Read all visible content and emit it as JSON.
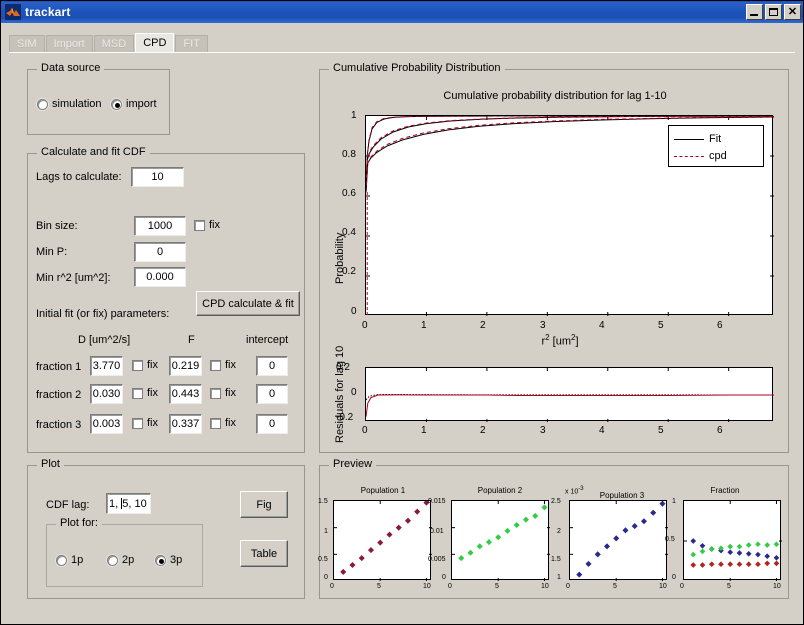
{
  "window": {
    "title": "trackart",
    "icon": "matlab-logo-icon",
    "minimize_label": "–",
    "maximize_label": "□",
    "close_label": "✕"
  },
  "tabs": [
    {
      "label": "SIM",
      "active": false
    },
    {
      "label": "Import",
      "active": false
    },
    {
      "label": "MSD",
      "active": false
    },
    {
      "label": "CPD",
      "active": true
    },
    {
      "label": "FIT",
      "active": false
    }
  ],
  "data_source": {
    "title": "Data source",
    "options": [
      {
        "label": "simulation",
        "selected": false
      },
      {
        "label": "import",
        "selected": true
      }
    ]
  },
  "calc_panel": {
    "title": "Calculate and fit CDF",
    "lags_label": "Lags to calculate:",
    "lags_value": "10",
    "bin_label": "Bin size:",
    "bin_value": "1000",
    "bin_fix_label": "fix",
    "bin_fix_checked": false,
    "minp_label": "Min P:",
    "minp_value": "0",
    "minr2_label": "Min r^2 [um^2]:",
    "minr2_value": "0.000",
    "calc_button": "CPD calculate & fit",
    "initial_label": "Initial fit (or fix) parameters:",
    "col_d": "D [um^2/s]",
    "col_f": "F",
    "col_intercept": "intercept",
    "fix_label": "fix",
    "rows": [
      {
        "name": "fraction 1",
        "d": "3.770",
        "d_fix": false,
        "f": "0.219",
        "f_fix": false,
        "intercept": "0"
      },
      {
        "name": "fraction 2",
        "d": "0.030",
        "d_fix": false,
        "f": "0.443",
        "f_fix": false,
        "intercept": "0"
      },
      {
        "name": "fraction 3",
        "d": "0.003",
        "d_fix": false,
        "f": "0.337",
        "f_fix": false,
        "intercept": "0"
      }
    ]
  },
  "plot_panel": {
    "title": "Plot",
    "cdf_lag_label": "CDF lag:",
    "cdf_lag_value": "1, 5, 10",
    "plot_for_title": "Plot for:",
    "plot_for_options": [
      {
        "label": "1p",
        "selected": false
      },
      {
        "label": "2p",
        "selected": false
      },
      {
        "label": "3p",
        "selected": true
      }
    ],
    "fig_button": "Fig",
    "table_button": "Table"
  },
  "cpd_panel": {
    "title": "Cumulative Probability Distribution"
  },
  "preview_panel": {
    "title": "Preview"
  },
  "chart_data": [
    {
      "id": "main-cpd",
      "type": "line",
      "title": "Cumulative probability distribution for lag 1-10",
      "xlabel": "r² [um²]",
      "ylabel": "Probability",
      "xlim": [
        0,
        6.75
      ],
      "ylim": [
        0,
        1
      ],
      "xticks": [
        0,
        1,
        2,
        3,
        4,
        5,
        6
      ],
      "yticks": [
        0,
        0.2,
        0.4,
        0.6,
        0.8,
        1
      ],
      "grid": false,
      "legend": {
        "position": "top-right",
        "entries": [
          {
            "label": "Fit",
            "style": "solid",
            "color": "#000000"
          },
          {
            "label": "cpd",
            "style": "dashed",
            "color": "#b00020"
          }
        ]
      },
      "series": [
        {
          "name": "Fit lag 1",
          "style": "solid",
          "color": "#000000",
          "x": [
            0,
            0.02,
            0.05,
            0.1,
            0.18,
            0.3,
            0.45,
            0.65,
            0.9,
            1.2,
            1.6,
            2.1,
            2.7,
            3.4,
            4.2,
            5.1,
            6.0,
            6.75
          ],
          "y": [
            0.62,
            0.8,
            0.875,
            0.935,
            0.968,
            0.985,
            0.993,
            0.9965,
            0.998,
            0.999,
            0.9995,
            0.9997,
            0.9998,
            0.9999,
            0.9999,
            1.0,
            1.0,
            1.0
          ]
        },
        {
          "name": "Fit lag 5",
          "style": "solid",
          "color": "#000000",
          "x": [
            0,
            0.02,
            0.06,
            0.12,
            0.25,
            0.45,
            0.7,
            1.0,
            1.4,
            1.9,
            2.5,
            3.2,
            4.0,
            4.9,
            5.8,
            6.75
          ],
          "y": [
            0.62,
            0.78,
            0.815,
            0.845,
            0.885,
            0.92,
            0.945,
            0.962,
            0.975,
            0.984,
            0.99,
            0.994,
            0.9965,
            0.998,
            0.999,
            0.9995
          ]
        },
        {
          "name": "Fit lag 10",
          "style": "solid",
          "color": "#000000",
          "x": [
            0,
            0.03,
            0.08,
            0.18,
            0.35,
            0.6,
            0.95,
            1.35,
            1.85,
            2.45,
            3.1,
            3.9,
            4.7,
            5.6,
            6.75
          ],
          "y": [
            0.62,
            0.765,
            0.79,
            0.818,
            0.85,
            0.88,
            0.908,
            0.93,
            0.948,
            0.962,
            0.972,
            0.98,
            0.986,
            0.991,
            0.995
          ]
        },
        {
          "name": "cpd lag 1",
          "style": "dashed",
          "color": "#b00020",
          "x": [
            0,
            0.02,
            0.05,
            0.1,
            0.18,
            0.3,
            0.45,
            0.65,
            0.9,
            1.2,
            1.6,
            2.1,
            2.7,
            3.4,
            4.2,
            5.1,
            6.0,
            6.75
          ],
          "y": [
            0.62,
            0.8,
            0.882,
            0.942,
            0.972,
            0.988,
            0.994,
            0.997,
            0.9985,
            0.999,
            0.9995,
            0.9997,
            0.9998,
            0.9999,
            1.0,
            1.0,
            1.0,
            1.0
          ]
        },
        {
          "name": "cpd lag 5",
          "style": "dashed",
          "color": "#b00020",
          "x": [
            0,
            0.02,
            0.06,
            0.12,
            0.25,
            0.45,
            0.7,
            1.0,
            1.4,
            1.9,
            2.5,
            3.2,
            4.0,
            4.9,
            5.8,
            6.75
          ],
          "y": [
            0.62,
            0.78,
            0.822,
            0.852,
            0.892,
            0.926,
            0.949,
            0.965,
            0.977,
            0.985,
            0.991,
            0.995,
            0.997,
            0.9985,
            0.9992,
            0.9996
          ]
        },
        {
          "name": "cpd lag 10",
          "style": "dashed",
          "color": "#b00020",
          "x": [
            0,
            0.03,
            0.08,
            0.18,
            0.35,
            0.6,
            0.95,
            1.35,
            1.85,
            2.45,
            3.1,
            3.9,
            4.7,
            5.6,
            6.75
          ],
          "y": [
            0.62,
            0.765,
            0.795,
            0.825,
            0.858,
            0.888,
            0.915,
            0.936,
            0.953,
            0.966,
            0.975,
            0.983,
            0.988,
            0.993,
            0.996
          ]
        }
      ]
    },
    {
      "id": "residuals",
      "type": "line",
      "title": "",
      "ylabel": "Residuals for lag 10",
      "xlim": [
        0,
        6.75
      ],
      "ylim": [
        -0.2,
        0.2
      ],
      "xticks": [
        0,
        1,
        2,
        3,
        4,
        5,
        6
      ],
      "yticks": [
        -0.2,
        0,
        0.2
      ],
      "grid": false,
      "series": [
        {
          "name": "residual-black",
          "style": "dotted",
          "color": "#000000",
          "x": [
            0,
            0.05,
            0.1,
            0.2,
            0.4,
            0.8,
            1.2,
            2.0,
            3.0,
            4.0,
            5.0,
            6.0,
            6.75
          ],
          "y": [
            -0.035,
            -0.012,
            -0.004,
            0.003,
            0.004,
            0.003,
            0.002,
            0.001,
            0.001,
            0.001,
            0.001,
            0.0,
            0.0
          ]
        },
        {
          "name": "residual-red",
          "style": "solid",
          "color": "#b00020",
          "x": [
            0,
            0.03,
            0.08,
            0.2,
            0.5,
            1.0,
            2.0,
            2.5,
            3.5,
            5.0,
            6.0,
            6.75
          ],
          "y": [
            -0.16,
            -0.06,
            -0.02,
            0.0,
            0.001,
            0.0,
            0.0,
            -0.004,
            -0.004,
            -0.004,
            0.0,
            0.0
          ]
        }
      ]
    },
    {
      "id": "population-1",
      "type": "scatter",
      "title": "Population 1",
      "marker": "diamond",
      "color": "#8b1a3a",
      "xlim": [
        0,
        10.6
      ],
      "ylim": [
        0,
        1.5
      ],
      "xticks": [
        0,
        5,
        10
      ],
      "yticks": [
        0,
        0.5,
        1,
        1.5
      ],
      "x": [
        1,
        2,
        3,
        4,
        5,
        6,
        7,
        8,
        9,
        10
      ],
      "y": [
        0.17,
        0.3,
        0.43,
        0.58,
        0.72,
        0.87,
        1.0,
        1.13,
        1.3,
        1.47
      ]
    },
    {
      "id": "population-2",
      "type": "scatter",
      "title": "Population 2",
      "marker": "diamond",
      "color": "#33cc44",
      "xlim": [
        0,
        10.6
      ],
      "ylim": [
        0,
        0.015
      ],
      "xticks": [
        0,
        5,
        10
      ],
      "yticks": [
        0,
        0.005,
        0.01,
        0.015
      ],
      "x": [
        1,
        2,
        3,
        4,
        5,
        6,
        7,
        8,
        9,
        10
      ],
      "y": [
        0.0043,
        0.0053,
        0.0065,
        0.0073,
        0.0082,
        0.0094,
        0.0105,
        0.0115,
        0.0122,
        0.0138
      ]
    },
    {
      "id": "population-3",
      "type": "scatter",
      "title": "Population 3",
      "marker": "diamond",
      "color": "#2a2a8c",
      "exponent_label": "x 10",
      "exponent_value": "-3",
      "xlim": [
        0,
        10.6
      ],
      "ylim": [
        1,
        2.5
      ],
      "xticks": [
        0,
        5,
        10
      ],
      "yticks": [
        1,
        1.5,
        2,
        2.5
      ],
      "x": [
        1,
        2,
        3,
        4,
        5,
        6,
        7,
        8,
        9,
        10
      ],
      "y": [
        1.12,
        1.32,
        1.5,
        1.65,
        1.8,
        1.95,
        2.03,
        2.12,
        2.28,
        2.45
      ]
    },
    {
      "id": "fraction",
      "type": "scatter",
      "title": "Fraction",
      "marker": "diamond",
      "xlim": [
        0,
        10.6
      ],
      "ylim": [
        0,
        1
      ],
      "xticks": [
        0,
        5,
        10
      ],
      "yticks": [
        0,
        0.5,
        1
      ],
      "series": [
        {
          "name": "fraction-1",
          "color": "#2a2a8c",
          "x": [
            1,
            2,
            3,
            4,
            5,
            6,
            7,
            8,
            9,
            10
          ],
          "y": [
            0.5,
            0.44,
            0.4,
            0.38,
            0.36,
            0.35,
            0.34,
            0.33,
            0.31,
            0.29
          ]
        },
        {
          "name": "fraction-2",
          "color": "#33cc44",
          "x": [
            1,
            2,
            3,
            4,
            5,
            6,
            7,
            8,
            9,
            10
          ],
          "y": [
            0.33,
            0.37,
            0.4,
            0.41,
            0.43,
            0.43,
            0.45,
            0.46,
            0.45,
            0.46
          ]
        },
        {
          "name": "fraction-3",
          "color": "#b0251f",
          "x": [
            1,
            2,
            3,
            4,
            5,
            6,
            7,
            8,
            9,
            10
          ],
          "y": [
            0.2,
            0.2,
            0.21,
            0.21,
            0.21,
            0.21,
            0.21,
            0.21,
            0.22,
            0.22
          ]
        }
      ]
    }
  ]
}
